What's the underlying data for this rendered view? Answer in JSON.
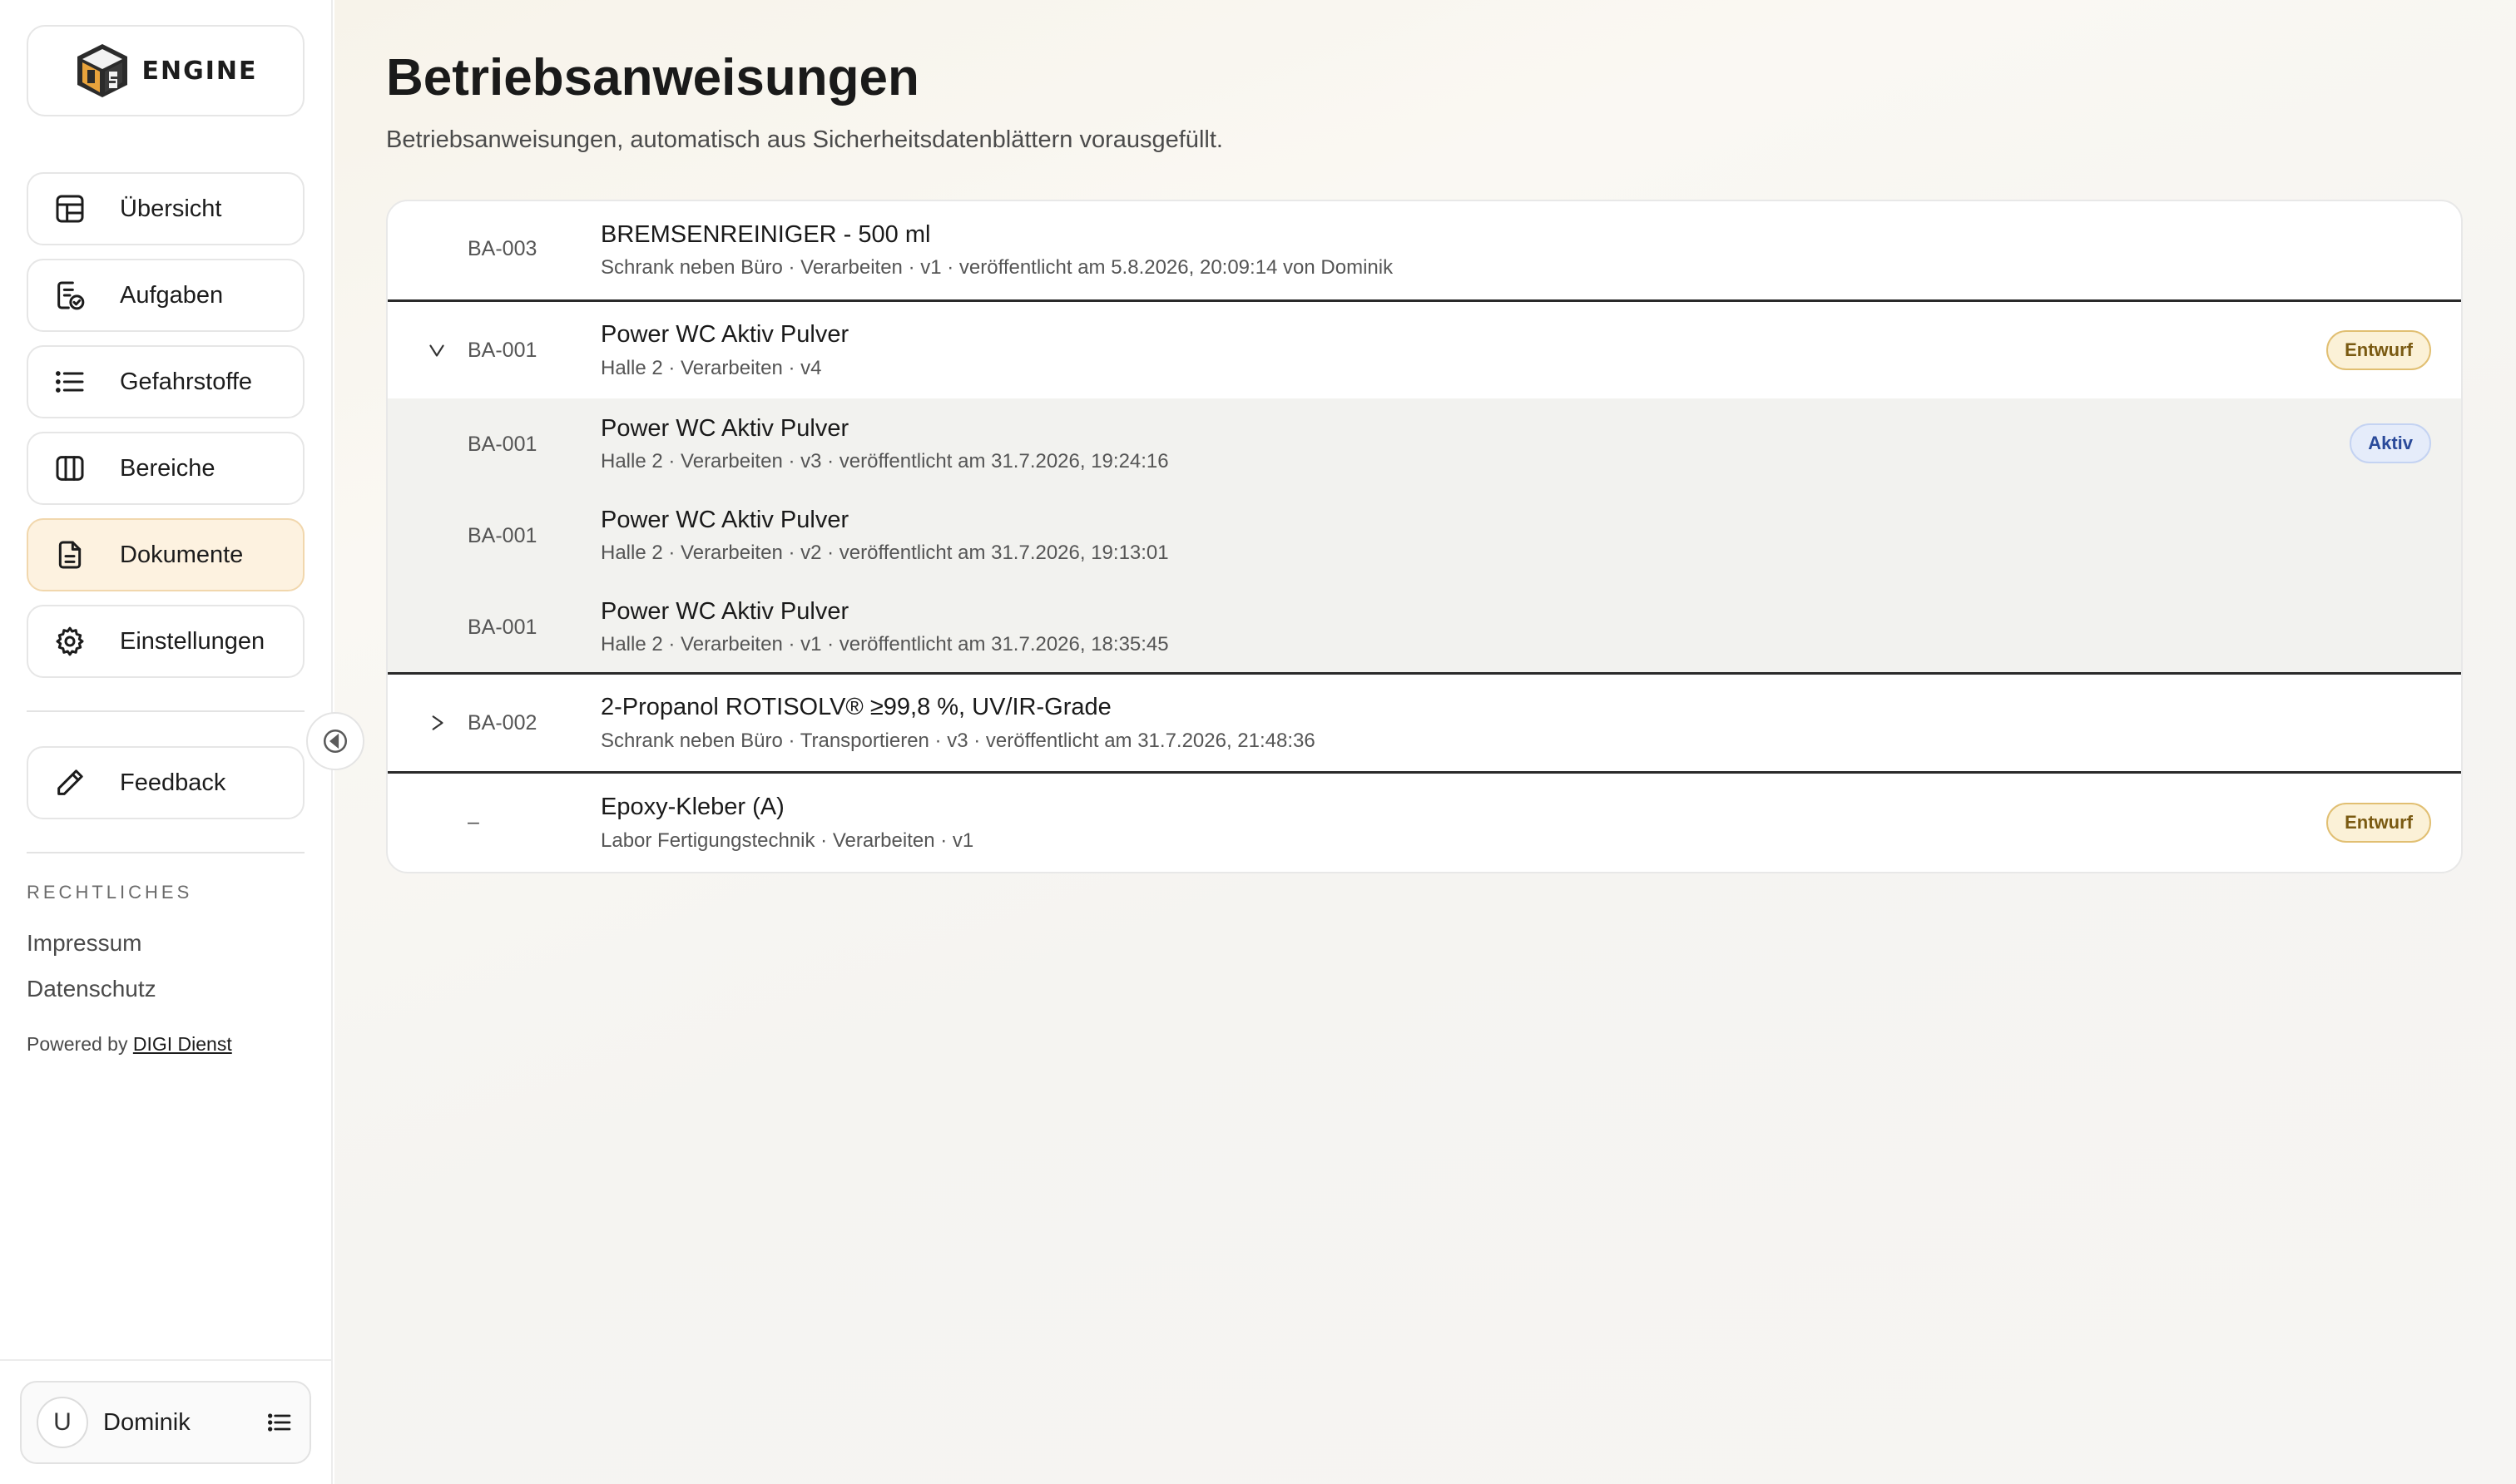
{
  "brand": {
    "name": "ENGINE"
  },
  "nav": [
    {
      "label": "Übersicht",
      "icon": "layout-icon"
    },
    {
      "label": "Aufgaben",
      "icon": "task-icon"
    },
    {
      "label": "Gefahrstoffe",
      "icon": "list-icon"
    },
    {
      "label": "Bereiche",
      "icon": "columns-icon"
    },
    {
      "label": "Dokumente",
      "icon": "document-icon",
      "active": true
    },
    {
      "label": "Einstellungen",
      "icon": "gear-icon"
    }
  ],
  "feedback": {
    "label": "Feedback"
  },
  "legal": {
    "heading": "RECHTLICHES",
    "impressum": "Impressum",
    "datenschutz": "Datenschutz",
    "powered_prefix": "Powered by ",
    "powered_link": "DIGI Dienst"
  },
  "user": {
    "initial": "U",
    "name": "Dominik"
  },
  "page": {
    "title": "Betriebsanweisungen",
    "subtitle": "Betriebsanweisungen, automatisch aus Sicherheitsdatenblättern vorausgefüllt."
  },
  "rows": [
    {
      "code": "BA-003",
      "title": "BREMSENREINIGER - 500 ml",
      "meta": "Schrank neben Büro · Verarbeiten · v1 · veröffentlicht am 5.8.2026, 20:09:14 von Dominik",
      "badge": ""
    },
    {
      "code": "BA-001",
      "title": "Power WC Aktiv Pulver",
      "meta": "Halle 2 · Verarbeiten · v4",
      "badge": "Entwurf",
      "expanded": true
    },
    {
      "code": "BA-001",
      "title": "Power WC Aktiv Pulver",
      "meta": "Halle 2 · Verarbeiten · v3 · veröffentlicht am 31.7.2026, 19:24:16",
      "badge": "Aktiv"
    },
    {
      "code": "BA-001",
      "title": "Power WC Aktiv Pulver",
      "meta": "Halle 2 · Verarbeiten · v2 · veröffentlicht am 31.7.2026, 19:13:01",
      "badge": ""
    },
    {
      "code": "BA-001",
      "title": "Power WC Aktiv Pulver",
      "meta": "Halle 2 · Verarbeiten · v1 · veröffentlicht am 31.7.2026, 18:35:45",
      "badge": ""
    },
    {
      "code": "BA-002",
      "title": "2-Propanol ROTISOLV® ≥99,8 %, UV/IR-Grade",
      "meta": "Schrank neben Büro · Transportieren · v3 · veröffentlicht am 31.7.2026, 21:48:36",
      "badge": ""
    },
    {
      "code": "–",
      "title": "Epoxy-Kleber (A)",
      "meta": "Labor Fertigungstechnik · Verarbeiten · v1",
      "badge": "Entwurf"
    }
  ]
}
